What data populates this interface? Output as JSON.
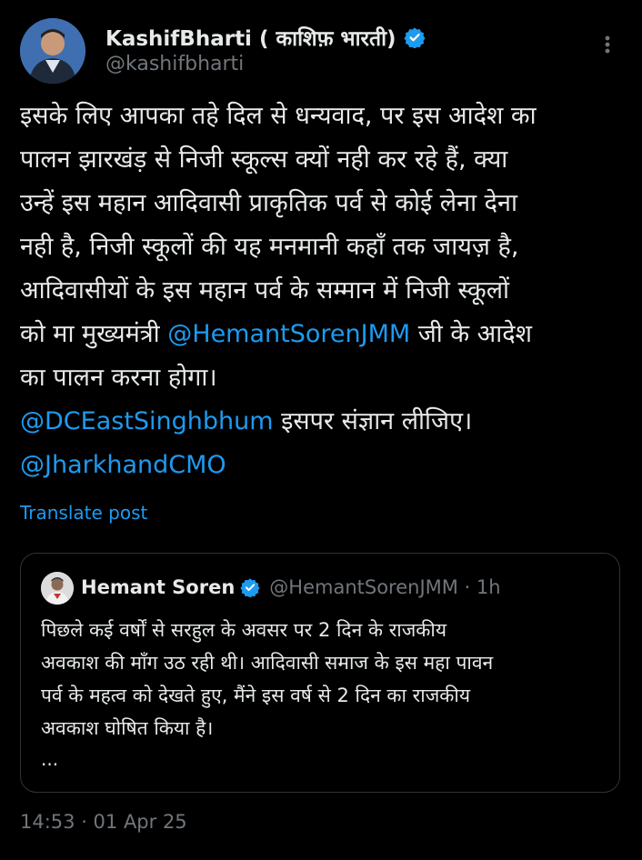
{
  "author": {
    "display_name": "KashifBharti ( काशिफ़ भारती)",
    "handle": "@kashifbharti"
  },
  "post": {
    "lines": [
      "इसके लिए आपका तहे दिल से धन्यवाद, पर इस आदेश का",
      "पालन झारखंड़ से निजी स्कूल्स क्यों नही कर रहे हैं, क्या",
      "उन्हें इस महान आदिवासी प्राकृतिक पर्व से कोई लेना देना",
      "नही है, निजी स्कूलों की यह मनमानी कहाँ तक जायज़ है,",
      "आदिवासीयों के इस महान पर्व के सम्मान में निजी स्कूलों"
    ],
    "line6_before": "को मा मुख्यमंत्री ",
    "mention_1": "@HemantSorenJMM",
    "line6_after": " जी के आदेश",
    "line7": "का पालन करना होगा।",
    "mention_2": "@DCEastSinghbhum",
    "line8_after": " इसपर संज्ञान लीजिए।",
    "mention_3": "@JharkhandCMO"
  },
  "translate_label": "Translate post",
  "quoted": {
    "display_name": "Hemant Soren",
    "handle_time": "@HemantSorenJMM · 1h",
    "lines": [
      "पिछले कई वर्षों से सरहुल के अवसर पर 2 दिन के राजकीय",
      "अवकाश की माँग उठ रही थी। आदिवासी समाज के इस महा पावन",
      "पर्व के महत्व को देखते हुए, मैंने इस वर्ष से 2 दिन का राजकीय",
      "अवकाश घोषित किया है।"
    ],
    "ellipsis": "..."
  },
  "timestamp": "14:53 · 01 Apr 25",
  "colors": {
    "background": "#000000",
    "text": "#e7e9ea",
    "muted": "#71767b",
    "accent": "#1d9bf0",
    "border": "#2f3336"
  },
  "icons": {
    "verified": "verified-badge-icon",
    "more": "more-options-icon"
  }
}
